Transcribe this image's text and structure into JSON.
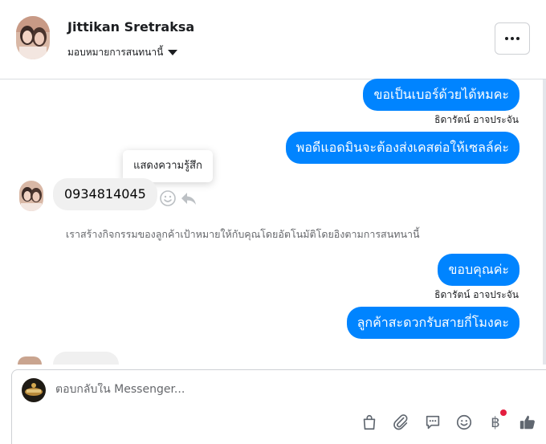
{
  "header": {
    "name": "Jittikan Sretraksa",
    "assign_label": "มอบหมายการสนทนานี้",
    "more_icon": "more-horizontal-icon"
  },
  "messages": {
    "out1": "ขอเป็นเบอร์ด้วยได้หมคะ",
    "sender1": "ธิดารัตน์ อาจประจัน",
    "out2": "พอดีแอดมินจะต้องส่งเคสต่อให้เซลล์ค่ะ",
    "tooltip": "แสดงความรู้สึก",
    "in1": "0934814045",
    "system_note": "เราสร้างกิจกรรมของลูกค้าเป้าหมายให้กับคุณโดยอัตโนมัติโดยอิงตามการสนทนานี้",
    "out3": "ขอบคุณค่ะ",
    "sender2": "ธิดารัตน์ อาจประจัน",
    "out4": "ลูกค้าสะดวกรับสายกี่โมงคะ"
  },
  "composer": {
    "placeholder": "ตอบกลับใน Messenger...",
    "currency_symbol": "฿"
  },
  "colors": {
    "accent": "#0084ff",
    "incoming_bubble": "#f0f0f0",
    "notification_dot": "#e41e3f",
    "icon": "#606770"
  }
}
